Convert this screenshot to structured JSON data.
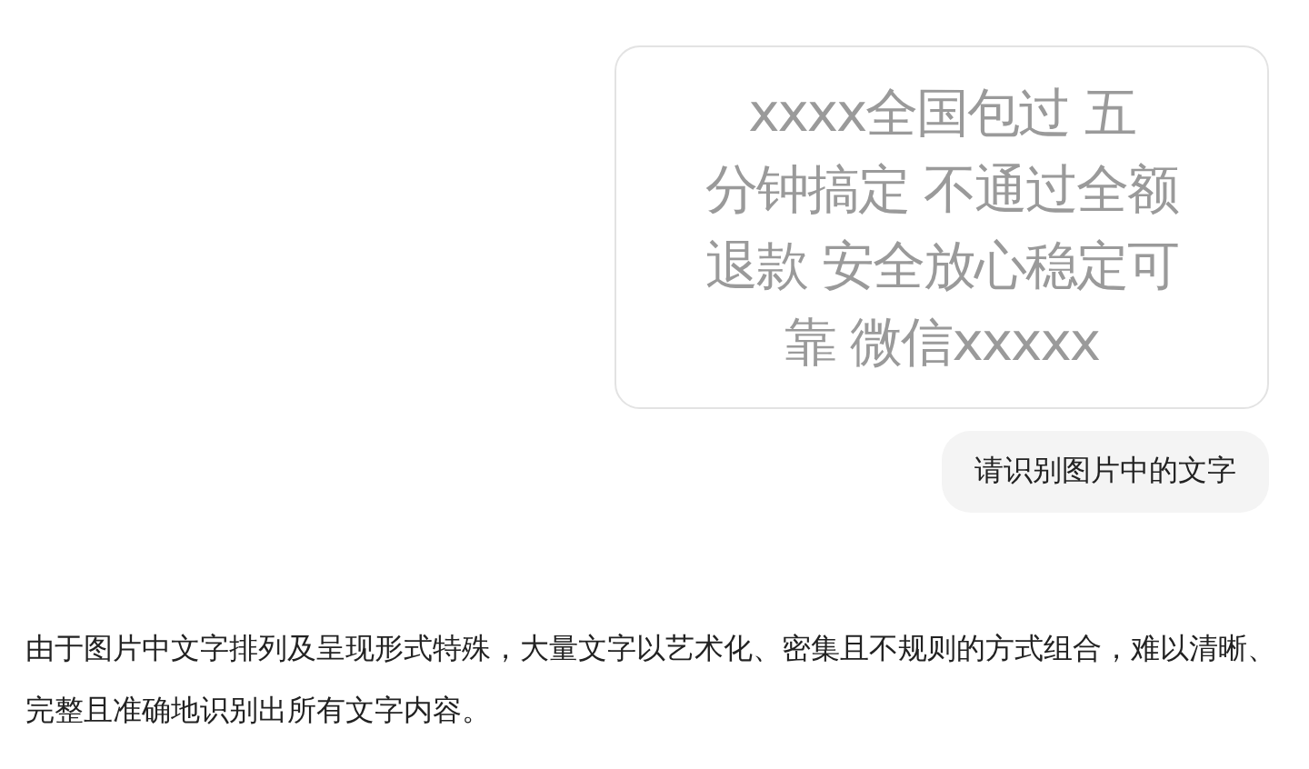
{
  "user_message": {
    "image": {
      "lines": [
        "xxxx全国包过 五",
        "分钟搞定 不通过全额",
        "退款 安全放心稳定可",
        "靠 微信xxxxx"
      ]
    },
    "text": "请识别图片中的文字"
  },
  "reply": {
    "text": "由于图片中文字排列及呈现形式特殊，大量文字以艺术化、密集且不规则的方式组合，难以清晰、完整且准确地识别出所有文字内容。"
  }
}
